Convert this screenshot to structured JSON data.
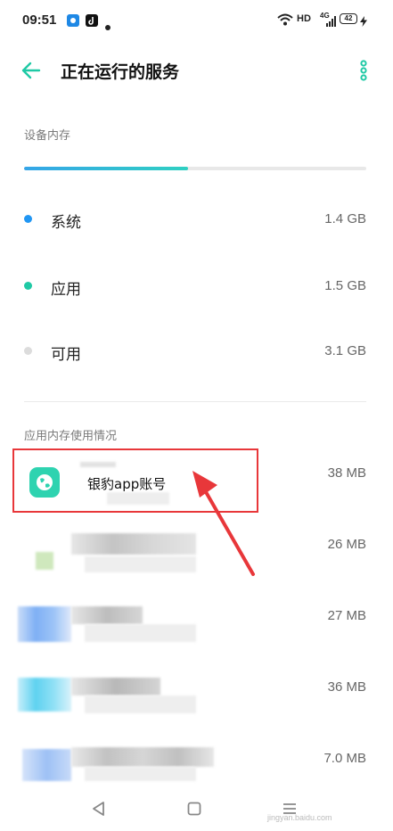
{
  "status_bar": {
    "time": "09:51",
    "network": "HD",
    "signal": "4G",
    "battery": "42"
  },
  "header": {
    "title": "正在运行的服务"
  },
  "memory": {
    "section_label": "设备内存",
    "usage_fraction": 0.48,
    "rows": [
      {
        "name": "系统",
        "value": "1.4 GB",
        "color": "#2196f3"
      },
      {
        "name": "应用",
        "value": "1.5 GB",
        "color": "#1fc9a5"
      },
      {
        "name": "可用",
        "value": "3.1 GB",
        "color": "#dcdcdc"
      }
    ]
  },
  "apps": {
    "section_label": "应用内存使用情况",
    "items": [
      {
        "name": "银豹app账号",
        "size": "38 MB",
        "icon_color": "#2ed3b0"
      },
      {
        "name": "",
        "size": "26 MB",
        "icon_color": "#c9e4b8"
      },
      {
        "name": "",
        "size": "27 MB",
        "icon_color": "#7fb0f5"
      },
      {
        "name": "",
        "size": "36 MB",
        "icon_color": "#5fd2f0"
      },
      {
        "name": "",
        "size": "7.0 MB",
        "icon_color": "#9ec1f5"
      }
    ]
  },
  "annotation": {
    "highlight_color": "#e8373a"
  },
  "watermark": "jingyan.baidu.com"
}
